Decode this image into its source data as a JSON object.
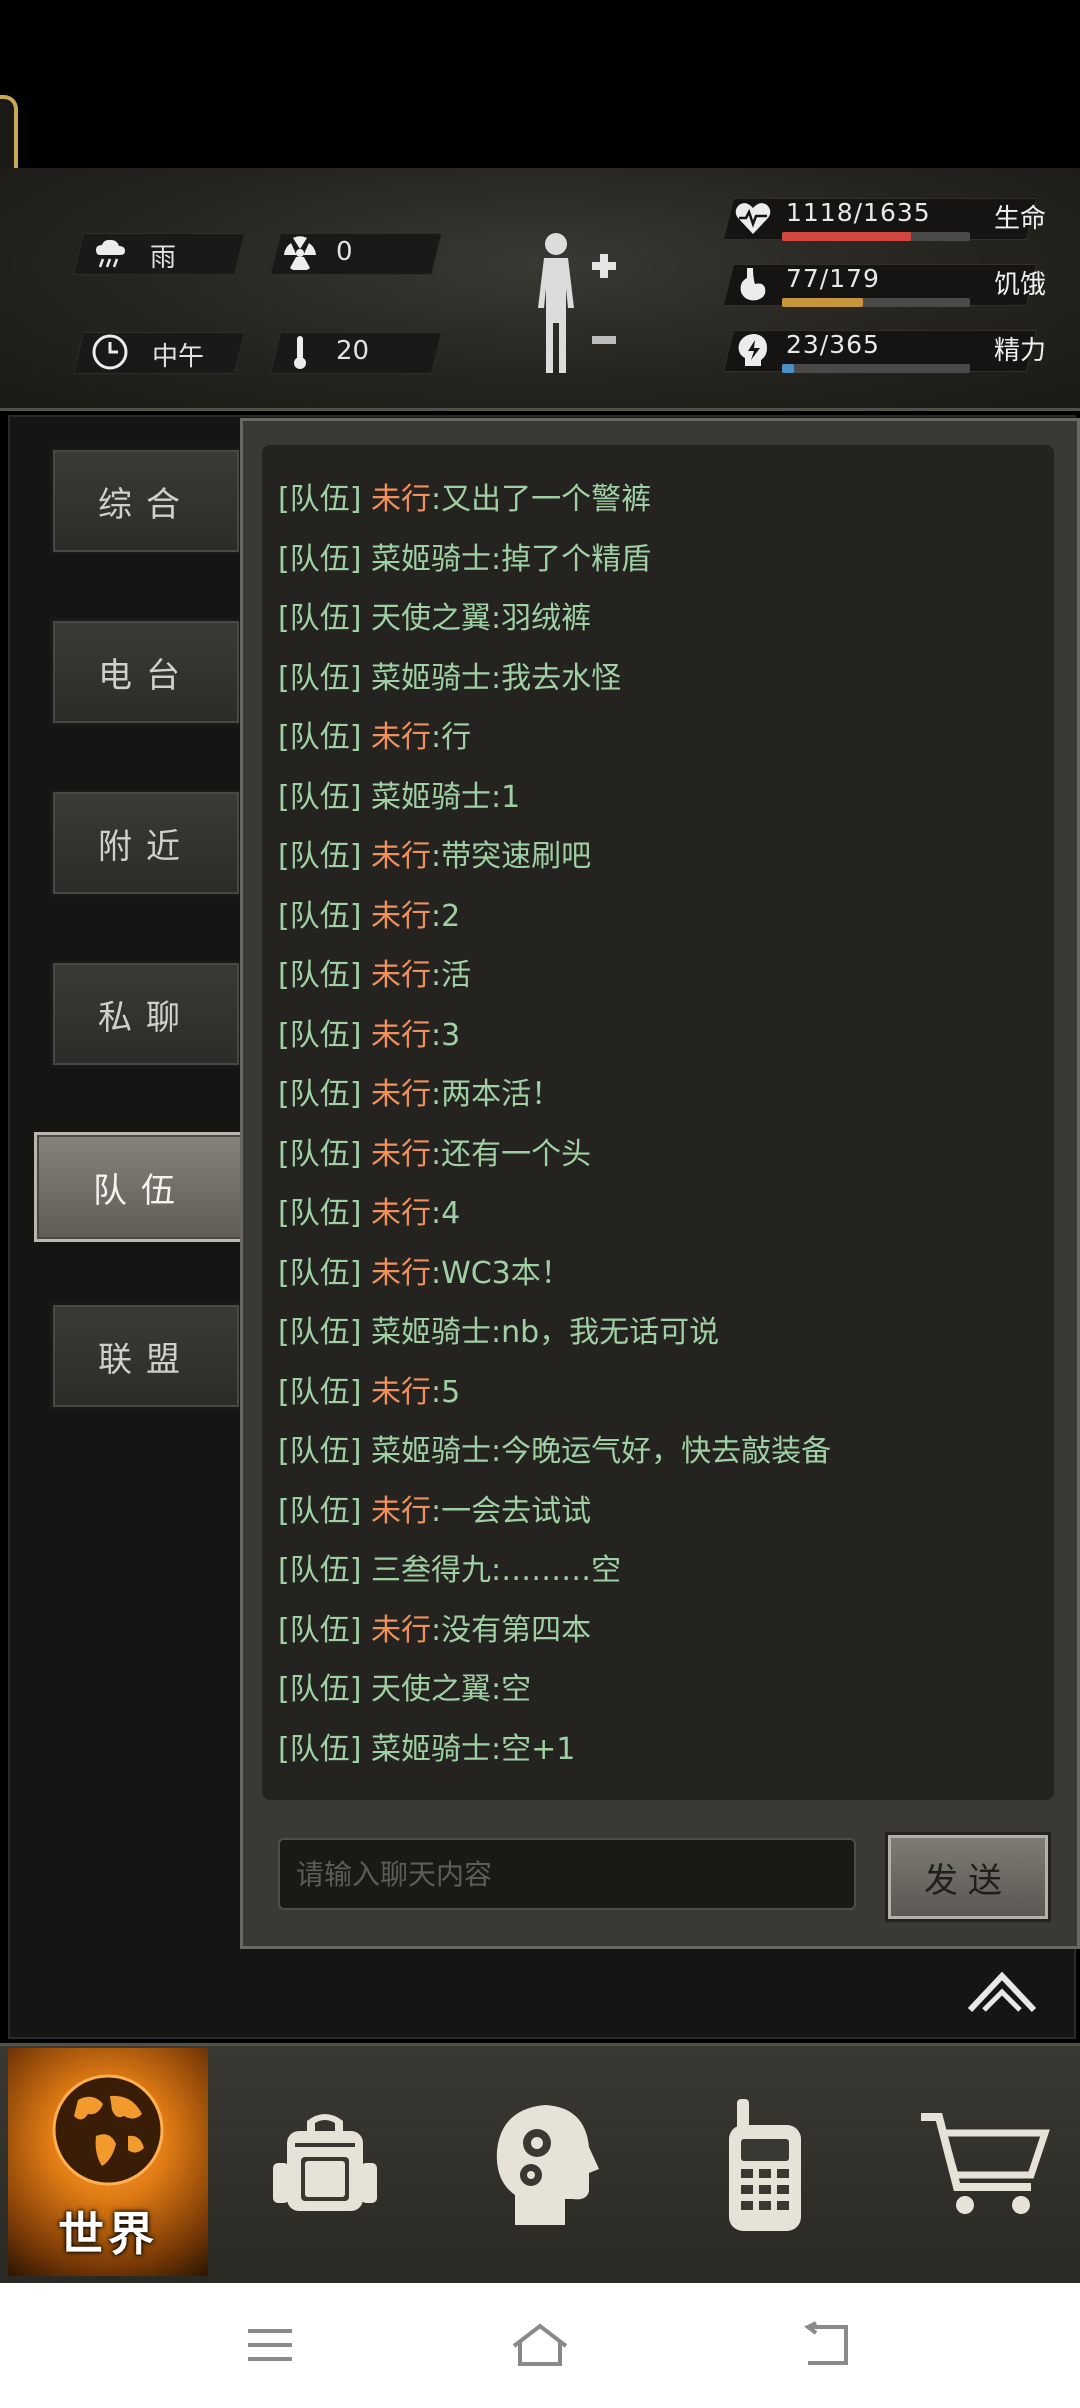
{
  "status": {
    "weather": "雨",
    "radiation": "0",
    "time_of_day": "中午",
    "temperature": "20"
  },
  "vitals": [
    {
      "key": "life",
      "value": "1118/1635",
      "label": "生命",
      "fraction": 0.684,
      "color": "#d2473f"
    },
    {
      "key": "hunger",
      "value": "77/179",
      "label": "饥饿",
      "fraction": 0.43,
      "color": "#c8963a"
    },
    {
      "key": "energy",
      "value": "23/365",
      "label": "精力",
      "fraction": 0.063,
      "color": "#4a8fc8"
    }
  ],
  "tabs": [
    "综合",
    "电台",
    "附近",
    "私聊",
    "队伍",
    "联盟"
  ],
  "active_tab": "队伍",
  "messages": [
    {
      "tag": "[队伍]",
      "nick": "未行",
      "nick_color": "orange",
      "text": ":又出了一个警裤"
    },
    {
      "tag": "[队伍]",
      "nick": "菜姬骑士",
      "nick_color": "green",
      "text": ":掉了个精盾"
    },
    {
      "tag": "[队伍]",
      "nick": "天使之翼",
      "nick_color": "green",
      "text": ":羽绒裤"
    },
    {
      "tag": "[队伍]",
      "nick": "菜姬骑士",
      "nick_color": "green",
      "text": ":我去水怪"
    },
    {
      "tag": "[队伍]",
      "nick": "未行",
      "nick_color": "orange",
      "text": ":行"
    },
    {
      "tag": "[队伍]",
      "nick": "菜姬骑士",
      "nick_color": "green",
      "text": ":1"
    },
    {
      "tag": "[队伍]",
      "nick": "未行",
      "nick_color": "orange",
      "text": ":带突速刷吧"
    },
    {
      "tag": "[队伍]",
      "nick": "未行",
      "nick_color": "orange",
      "text": ":2"
    },
    {
      "tag": "[队伍]",
      "nick": "未行",
      "nick_color": "orange",
      "text": ":活"
    },
    {
      "tag": "[队伍]",
      "nick": "未行",
      "nick_color": "orange",
      "text": ":3"
    },
    {
      "tag": "[队伍]",
      "nick": "未行",
      "nick_color": "orange",
      "text": ":两本活！"
    },
    {
      "tag": "[队伍]",
      "nick": "未行",
      "nick_color": "orange",
      "text": ":还有一个头"
    },
    {
      "tag": "[队伍]",
      "nick": "未行",
      "nick_color": "orange",
      "text": ":4"
    },
    {
      "tag": "[队伍]",
      "nick": "未行",
      "nick_color": "orange",
      "text": ":WC3本！"
    },
    {
      "tag": "[队伍]",
      "nick": "菜姬骑士",
      "nick_color": "green",
      "text": ":nb，我无话可说"
    },
    {
      "tag": "[队伍]",
      "nick": "未行",
      "nick_color": "orange",
      "text": ":5"
    },
    {
      "tag": "[队伍]",
      "nick": "菜姬骑士",
      "nick_color": "green",
      "text": ":今晚运气好，快去敲装备"
    },
    {
      "tag": "[队伍]",
      "nick": "未行",
      "nick_color": "orange",
      "text": ":一会去试试"
    },
    {
      "tag": "[队伍]",
      "nick": "三叁得九",
      "nick_color": "green",
      "text": ":………空"
    },
    {
      "tag": "[队伍]",
      "nick": "未行",
      "nick_color": "orange",
      "text": ":没有第四本"
    },
    {
      "tag": "[队伍]",
      "nick": "天使之翼",
      "nick_color": "green",
      "text": ":空"
    },
    {
      "tag": "[队伍]",
      "nick": "菜姬骑士",
      "nick_color": "green",
      "text": ":空+1"
    }
  ],
  "input": {
    "placeholder": "请输入聊天内容",
    "value": ""
  },
  "send_label": "发送",
  "bottom_nav": {
    "world_label": "世界",
    "items": [
      "world-icon",
      "backpack-icon",
      "skills-head-icon",
      "radio-icon",
      "cart-icon"
    ]
  },
  "system_nav": [
    "menu-icon",
    "home-icon",
    "back-icon"
  ]
}
